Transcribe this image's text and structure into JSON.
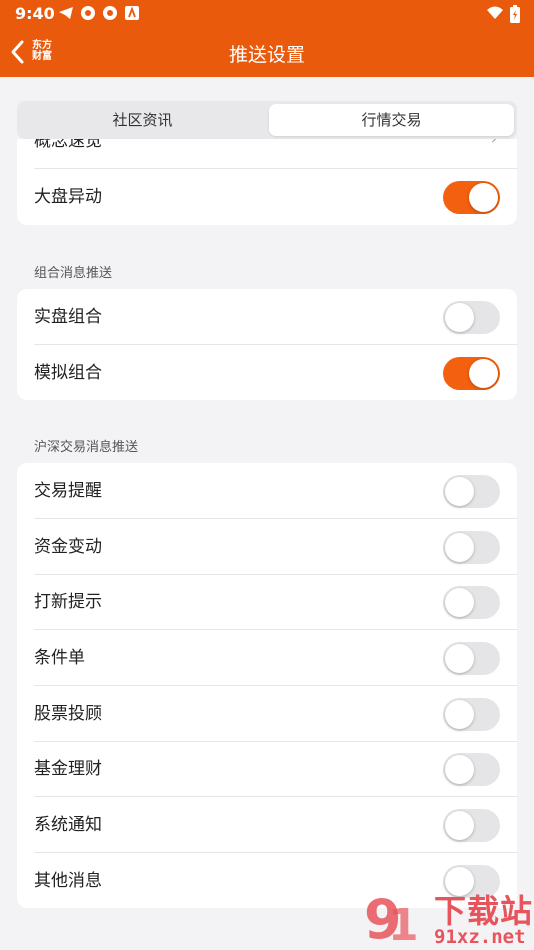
{
  "status": {
    "time": "9:40"
  },
  "header": {
    "title": "推送设置",
    "logo_line1": "东方",
    "logo_line2": "财富"
  },
  "tabs": [
    {
      "label": "社区资讯",
      "active": false
    },
    {
      "label": "行情交易",
      "active": true
    }
  ],
  "card1": {
    "items": [
      {
        "label": "概念速览"
      },
      {
        "label": "大盘异动",
        "on": true
      }
    ]
  },
  "sections": [
    {
      "title": "组合消息推送",
      "items": [
        {
          "label": "实盘组合",
          "on": false
        },
        {
          "label": "模拟组合",
          "on": true
        }
      ]
    },
    {
      "title": "沪深交易消息推送",
      "items": [
        {
          "label": "交易提醒",
          "on": false
        },
        {
          "label": "资金变动",
          "on": false
        },
        {
          "label": "打新提示",
          "on": false
        },
        {
          "label": "条件单",
          "on": false
        },
        {
          "label": "股票投顾",
          "on": false
        },
        {
          "label": "基金理财",
          "on": false
        },
        {
          "label": "系统通知",
          "on": false
        },
        {
          "label": "其他消息",
          "on": false
        }
      ]
    }
  ],
  "watermark": {
    "main": "下载站",
    "sub": "91xz.net"
  },
  "colors": {
    "accent": "#ea5a0c",
    "toggle_on": "#f26010"
  }
}
